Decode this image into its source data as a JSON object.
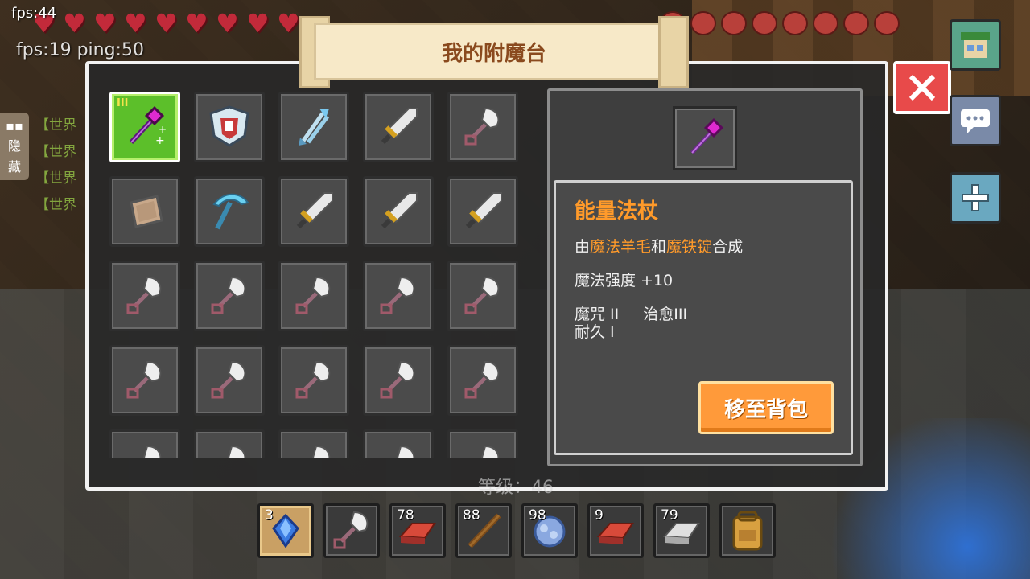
{
  "hud": {
    "fps_top": "fps:44",
    "fps_ping": "fps:19 ping:50",
    "hearts": 9,
    "food": 8
  },
  "side_tab": {
    "label_1": "隐",
    "label_2": "藏"
  },
  "chat": {
    "lines": [
      "【世界",
      "【世界",
      "【世界",
      "【世界"
    ]
  },
  "panel": {
    "title": "我的附魔台"
  },
  "inventory": {
    "slots": [
      {
        "icon": "magic-staff-icon",
        "selected": true,
        "tier": "III"
      },
      {
        "icon": "shield-emblem-icon"
      },
      {
        "icon": "crystal-arrows-icon"
      },
      {
        "icon": "iron-sword-icon"
      },
      {
        "icon": "iron-shovel-icon"
      },
      {
        "icon": "leather-armor-icon"
      },
      {
        "icon": "diamond-pickaxe-icon"
      },
      {
        "icon": "iron-sword-icon"
      },
      {
        "icon": "iron-sword-icon"
      },
      {
        "icon": "iron-sword-icon"
      },
      {
        "icon": "iron-shovel-icon"
      },
      {
        "icon": "iron-shovel-icon"
      },
      {
        "icon": "iron-shovel-icon"
      },
      {
        "icon": "iron-shovel-icon"
      },
      {
        "icon": "iron-shovel-icon"
      },
      {
        "icon": "iron-shovel-icon"
      },
      {
        "icon": "iron-shovel-icon"
      },
      {
        "icon": "iron-shovel-icon"
      },
      {
        "icon": "iron-shovel-icon"
      },
      {
        "icon": "iron-shovel-icon"
      },
      {
        "icon": "iron-shovel-icon"
      },
      {
        "icon": "iron-shovel-icon"
      },
      {
        "icon": "iron-shovel-icon"
      },
      {
        "icon": "iron-shovel-icon"
      },
      {
        "icon": "iron-shovel-icon"
      }
    ]
  },
  "detail": {
    "item_icon": "magic-staff-icon",
    "name": "能量法杖",
    "craft_prefix": "由",
    "material_1": "魔法羊毛",
    "craft_and": "和",
    "material_2": "魔铁锭",
    "craft_suffix": "合成",
    "stat": "魔法强度 +10",
    "enchant_1": "魔咒 II",
    "enchant_2": "治愈III",
    "enchant_3": "耐久 I",
    "move_button": "移至背包"
  },
  "level": "等级：46",
  "hotbar": [
    {
      "count": "3",
      "icon": "blue-gem-icon",
      "active": true
    },
    {
      "count": "",
      "icon": "iron-shovel-icon"
    },
    {
      "count": "78",
      "icon": "red-ingot-icon"
    },
    {
      "count": "88",
      "icon": "wooden-stick-icon"
    },
    {
      "count": "98",
      "icon": "blue-wool-icon"
    },
    {
      "count": "9",
      "icon": "red-ingot-icon"
    },
    {
      "count": "79",
      "icon": "iron-ingot-icon"
    },
    {
      "count": "",
      "icon": "backpack-icon"
    }
  ],
  "colors": {
    "accent_orange": "#ff9a2a",
    "close_red": "#e84a4a",
    "selected_green": "#5cbf2a"
  }
}
